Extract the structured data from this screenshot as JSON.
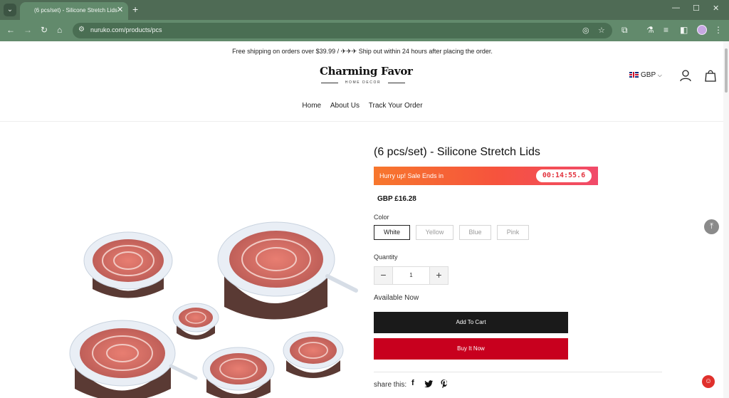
{
  "browser": {
    "tab_title": "(6 pcs/set) - Silicone Stretch Lids",
    "tab_close": "✕",
    "new_tab": "+",
    "url": "nuruko.com/products/pcs",
    "icons": [
      "tab-search-icon",
      "back-icon",
      "forward-icon",
      "reload-icon",
      "home-icon",
      "site-info-icon",
      "eye-off-icon",
      "star-icon",
      "extensions-icon",
      "labs-icon",
      "reading-list-icon",
      "side-panel-icon",
      "profile-avatar",
      "menu-icon",
      "minimize-icon",
      "maximize-icon",
      "close-icon"
    ]
  },
  "announcement": "Free shipping on orders over $39.99 / ✈✈✈ Ship out within 24 hours after placing the order.",
  "logo": {
    "title": "Charming Favor",
    "subtitle": "HOME DECOR"
  },
  "header": {
    "currency": "GBP",
    "icons": [
      "flag-uk-icon",
      "chevron-down-icon",
      "account-icon",
      "cart-icon"
    ]
  },
  "nav": {
    "items": [
      "Home",
      "About Us",
      "Track Your Order"
    ]
  },
  "product": {
    "title": "(6 pcs/set) - Silicone Stretch Lids",
    "sale_text": "Hurry up! Sale Ends in",
    "timer": "00:14:55.6",
    "price": "GBP £16.28",
    "color_label": "Color",
    "colors": [
      "White",
      "Yellow",
      "Blue",
      "Pink"
    ],
    "selected_color": "White",
    "quantity_label": "Quantity",
    "quantity": "1",
    "availability": "Available Now",
    "add_to_cart": "Add To Cart",
    "buy_now": "Buy It Now",
    "share_label": "share this:",
    "share_icons": [
      "facebook-icon",
      "twitter-icon",
      "pinterest-icon"
    ]
  },
  "colors": {
    "chrome_dark": "#4f6b55",
    "chrome": "#628a6c",
    "cart_button": "#1a1a1a",
    "buy_button": "#c8001e",
    "banner_start": "#f7772d",
    "banner_end": "#f14a6a"
  }
}
